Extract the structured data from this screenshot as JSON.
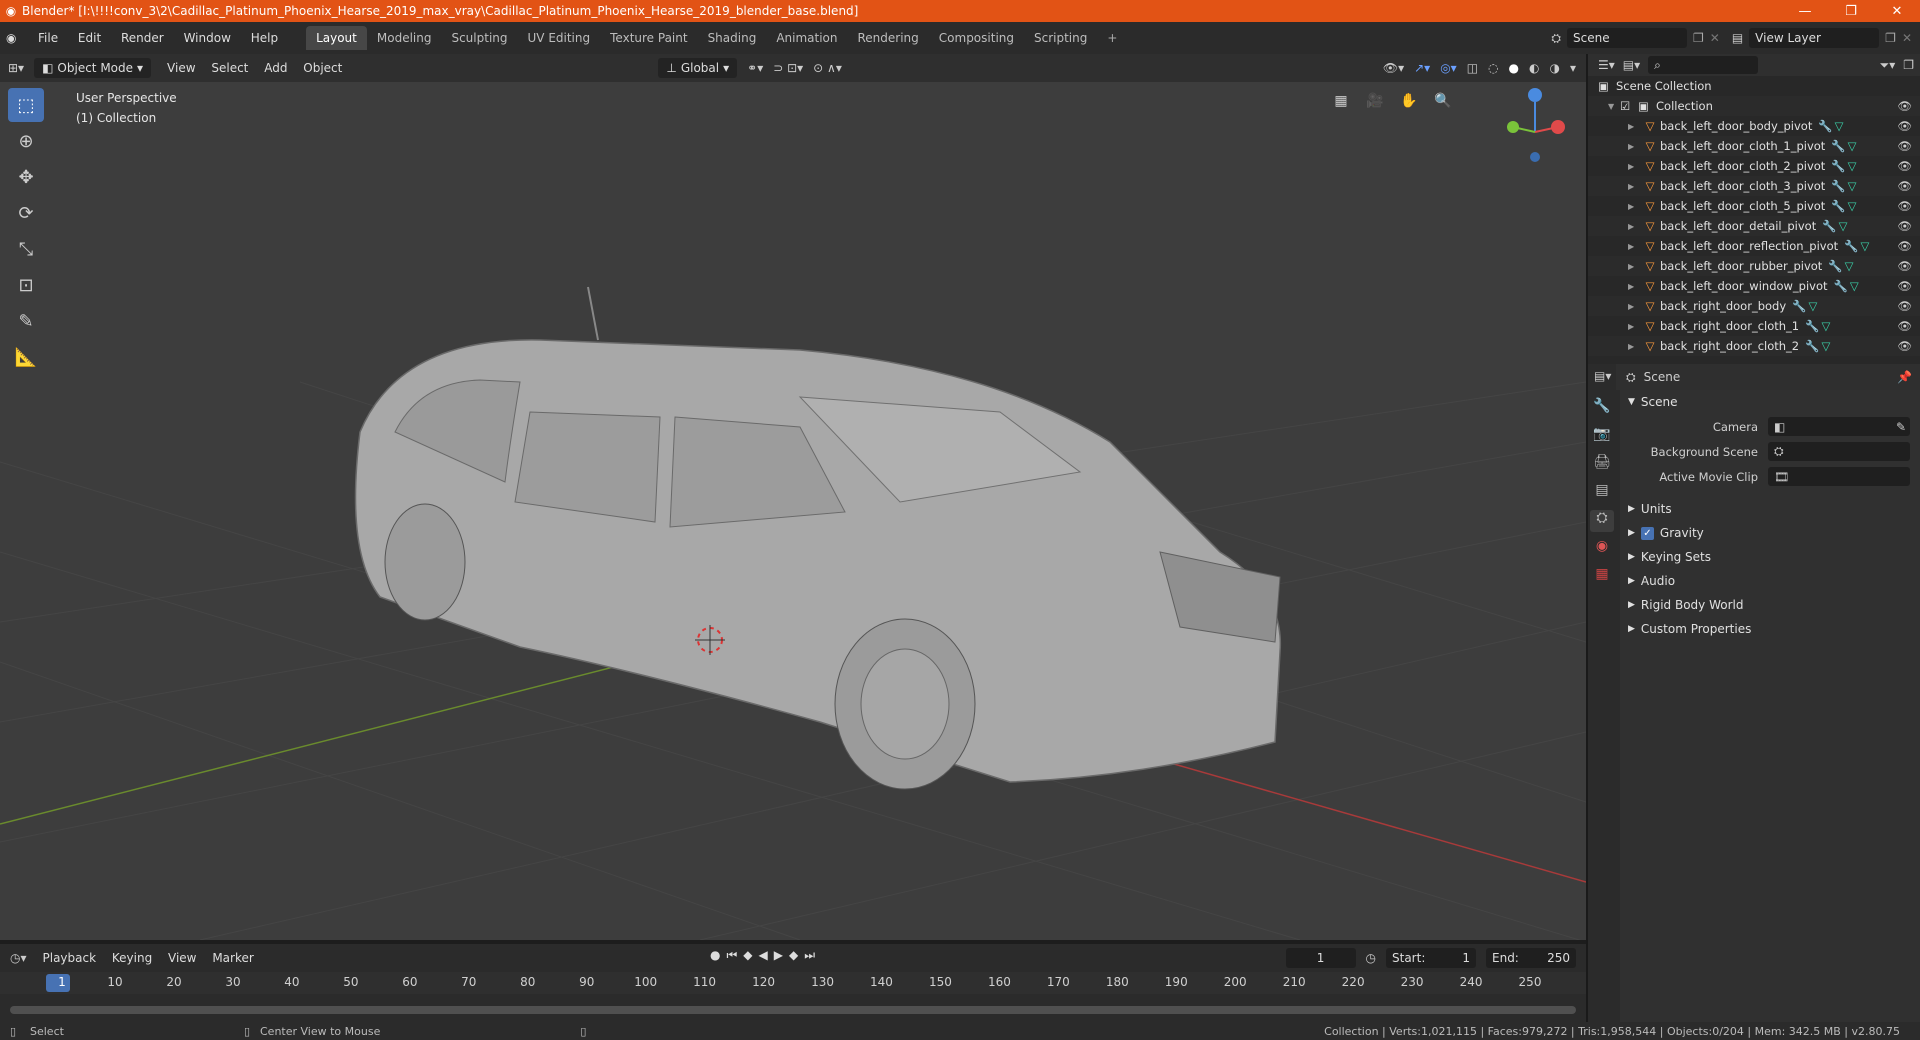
{
  "window": {
    "title": "Blender* [I:\\!!!!conv_3\\2\\Cadillac_Platinum_Phoenix_Hearse_2019_max_vray\\Cadillac_Platinum_Phoenix_Hearse_2019_blender_base.blend]",
    "minimize": "—",
    "maximize": "❐",
    "close": "✕"
  },
  "menubar": {
    "items": [
      "File",
      "Edit",
      "Render",
      "Window",
      "Help"
    ]
  },
  "workspaces": {
    "tabs": [
      "Layout",
      "Modeling",
      "Sculpting",
      "UV Editing",
      "Texture Paint",
      "Shading",
      "Animation",
      "Rendering",
      "Compositing",
      "Scripting"
    ],
    "active": "Layout",
    "add": "+"
  },
  "scene_selector": {
    "value": "Scene"
  },
  "viewlayer_selector": {
    "value": "View Layer"
  },
  "viewport_header": {
    "mode": "Object Mode",
    "menus": [
      "View",
      "Select",
      "Add",
      "Object"
    ],
    "transform_orientation": "Global"
  },
  "viewport": {
    "perspective": "User Perspective",
    "collection": "(1) Collection"
  },
  "outliner": {
    "root": "Scene Collection",
    "collection": "Collection",
    "objects": [
      "back_left_door_body_pivot",
      "back_left_door_cloth_1_pivot",
      "back_left_door_cloth_2_pivot",
      "back_left_door_cloth_3_pivot",
      "back_left_door_cloth_5_pivot",
      "back_left_door_detail_pivot",
      "back_left_door_reflection_pivot",
      "back_left_door_rubber_pivot",
      "back_left_door_window_pivot",
      "back_right_door_body",
      "back_right_door_cloth_1",
      "back_right_door_cloth_2"
    ]
  },
  "properties": {
    "context": "Scene",
    "panel_title": "Scene",
    "camera_label": "Camera",
    "background_scene_label": "Background Scene",
    "active_movie_clip_label": "Active Movie Clip",
    "sections": [
      "Units",
      "Gravity",
      "Keying Sets",
      "Audio",
      "Rigid Body World",
      "Custom Properties"
    ],
    "gravity_enabled": true
  },
  "timeline": {
    "menus": [
      "Playback",
      "Keying",
      "View",
      "Marker"
    ],
    "current_frame": "1",
    "start_label": "Start:",
    "start": "1",
    "end_label": "End:",
    "end": "250",
    "ruler": [
      "1",
      "10",
      "20",
      "30",
      "40",
      "50",
      "60",
      "70",
      "80",
      "90",
      "100",
      "110",
      "120",
      "130",
      "140",
      "150",
      "160",
      "170",
      "180",
      "190",
      "200",
      "210",
      "220",
      "230",
      "240",
      "250"
    ]
  },
  "statusbar": {
    "select": "Select",
    "center": "Center View to Mouse",
    "stats": "Collection | Verts:1,021,115 | Faces:979,272 | Tris:1,958,544 | Objects:0/204 | Mem: 342.5 MB | v2.80.75"
  }
}
